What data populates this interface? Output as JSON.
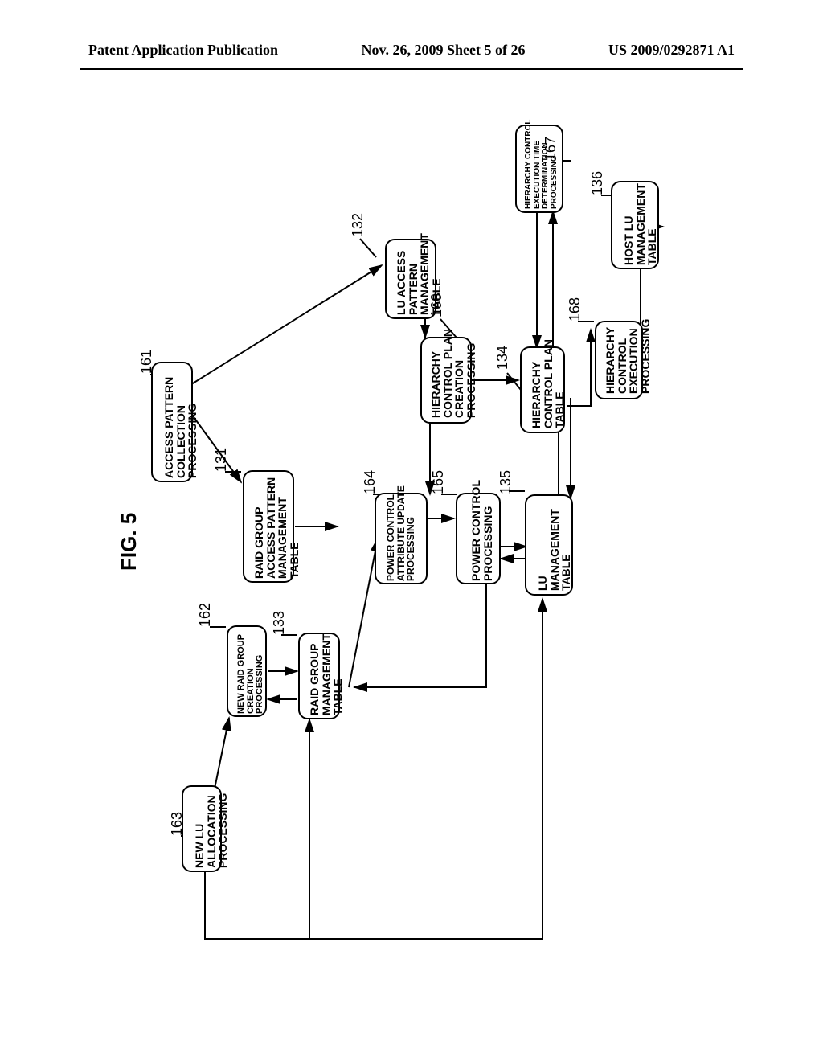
{
  "header": {
    "left": "Patent Application Publication",
    "center": "Nov. 26, 2009  Sheet 5 of 26",
    "right": "US 2009/0292871 A1"
  },
  "figure_label": "FIG. 5",
  "blocks": {
    "b161": "ACCESS PATTERN\nCOLLECTION\nPROCESSING",
    "b162": "NEW RAID GROUP\nCREATION\nPROCESSING",
    "b163": "NEW LU\nALLOCATION\nPROCESSING",
    "b131": "RAID GROUP\nACCESS PATTERN\nMANAGEMENT\nTABLE",
    "b132": "LU ACCESS\nPATTERN\nMANAGEMENT\nTABLE",
    "b133": "RAID GROUP\nMANAGEMENT\nTABLE",
    "b164": "POWER CONTROL\nATTRIBUTE UPDATE\nPROCESSING",
    "b166": "HIERARCHY\nCONTROL PLAN\nCREATION\nPROCESSING",
    "b165": "POWER CONTROL\nPROCESSING",
    "b134": "HIERARCHY\nCONTROL PLAN\nTABLE",
    "b167": "HIERARCHY CONTROL\nEXECUTION TIME\nDETERMINATION\nPROCESSING",
    "b135": "LU\nMANAGEMENT\nTABLE",
    "b168": "HIERARCHY\nCONTROL\nEXECUTION\nPROCESSING",
    "b136": "HOST LU\nMANAGEMENT\nTABLE"
  },
  "refs": {
    "r161": "161",
    "r162": "162",
    "r163": "163",
    "r131": "131",
    "r132": "132",
    "r133": "133",
    "r164": "164",
    "r166": "166",
    "r165": "165",
    "r134": "134",
    "r167": "167",
    "r135": "135",
    "r168": "168",
    "r136": "136"
  }
}
